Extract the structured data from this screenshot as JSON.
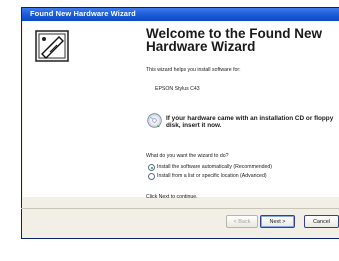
{
  "window": {
    "title": "Found New Hardware Wizard"
  },
  "wizard": {
    "heading": "Welcome to the Found New Hardware Wizard",
    "intro": "This wizard helps you install software for:",
    "device": "EPSON Stylus C43",
    "cd_prompt": "If your hardware came with an installation CD or floppy disk, insert it now.",
    "question": "What do you want the wizard to do?",
    "options": [
      {
        "label": "Install the software automatically (Recommended)",
        "selected": true
      },
      {
        "label": "Install from a list or specific location (Advanced)",
        "selected": false
      }
    ],
    "continue_text": "Click Next to continue."
  },
  "buttons": {
    "back": "< Back",
    "next": "Next >",
    "cancel": "Cancel"
  },
  "icons": {
    "hardware": "hardware-wizard-icon",
    "cd": "cd-icon"
  }
}
